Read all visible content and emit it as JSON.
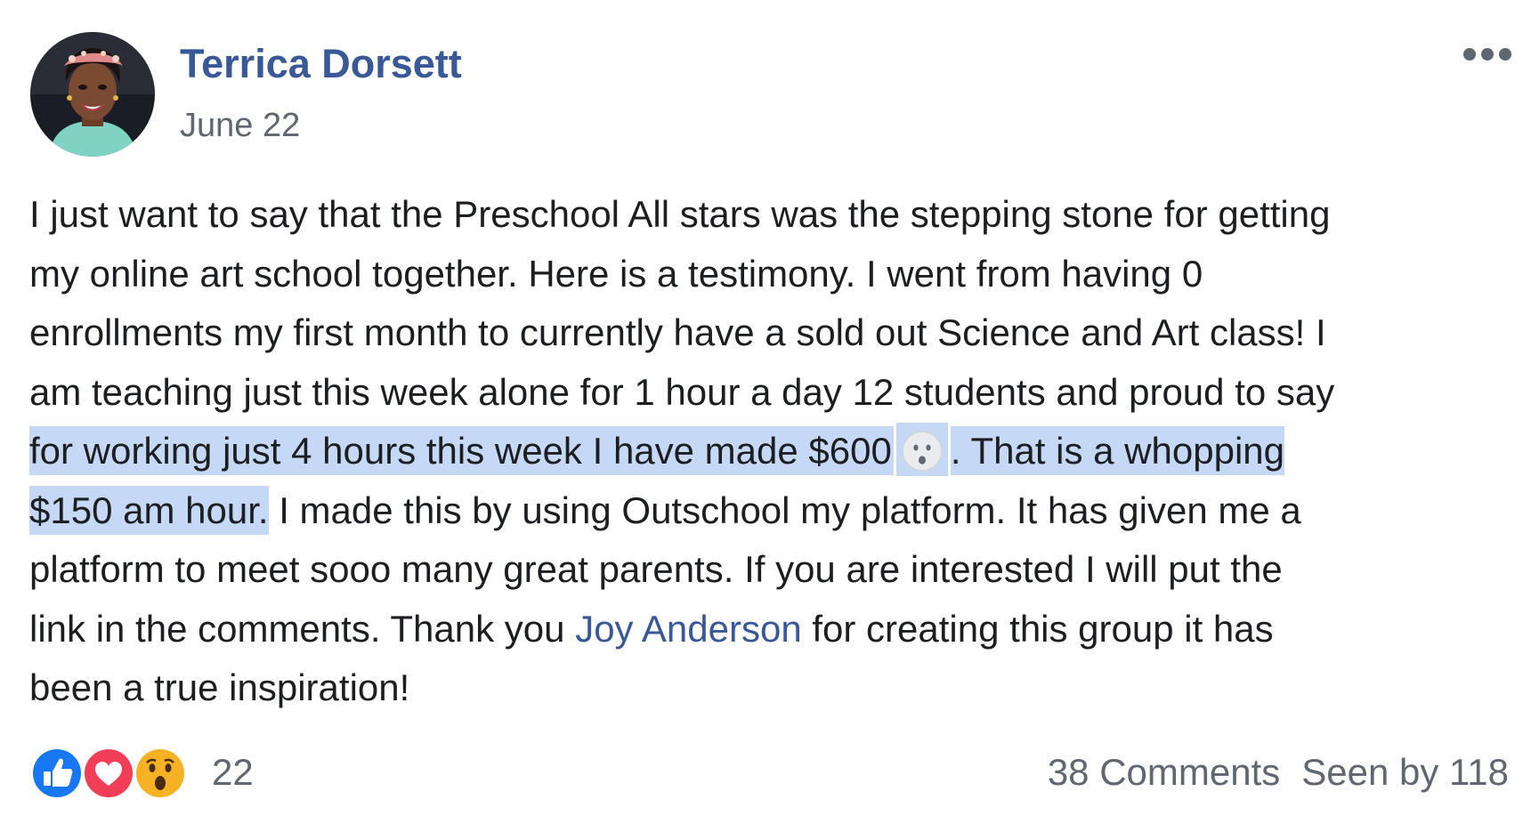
{
  "post": {
    "author": "Terrica Dorsett",
    "date": "June 22",
    "body": {
      "l1": "I just want to say that the Preschool All stars was the stepping stone for getting",
      "l2": "my online art school together. Here is a testimony. I went from having 0",
      "l3": "enrollments my first month to currently have a sold out Science and Art class! I",
      "l4": "am teaching just this week alone for 1 hour a day 12 students and proud to say",
      "l5_highlight_a": "for working just 4 hours this week I have made $600",
      "l5_highlight_b": ". That is a whopping",
      "l6_highlight": "$150 am hour.",
      "l6_rest": " I made this by using Outschool my platform. It has given me a",
      "l7": "platform to meet sooo many great parents. If you are interested I will put the",
      "l8_pre": "link in the comments. Thank you ",
      "l8_mention": "Joy Anderson",
      "l8_post": " for creating this group it has",
      "l9": "been a true inspiration!"
    },
    "emoji_icon": "hushed-face-icon",
    "reactions": {
      "icons": [
        "like-icon",
        "love-icon",
        "wow-icon"
      ],
      "count": "22"
    },
    "comments": "38 Comments",
    "seen_by": "Seen by 118"
  },
  "colors": {
    "link": "#385898",
    "secondary": "#606770",
    "text": "#1c1e21",
    "highlight": "#c5d8f5",
    "like": "#1877f2",
    "love": "#f33e58",
    "wow": "#f7b125"
  }
}
